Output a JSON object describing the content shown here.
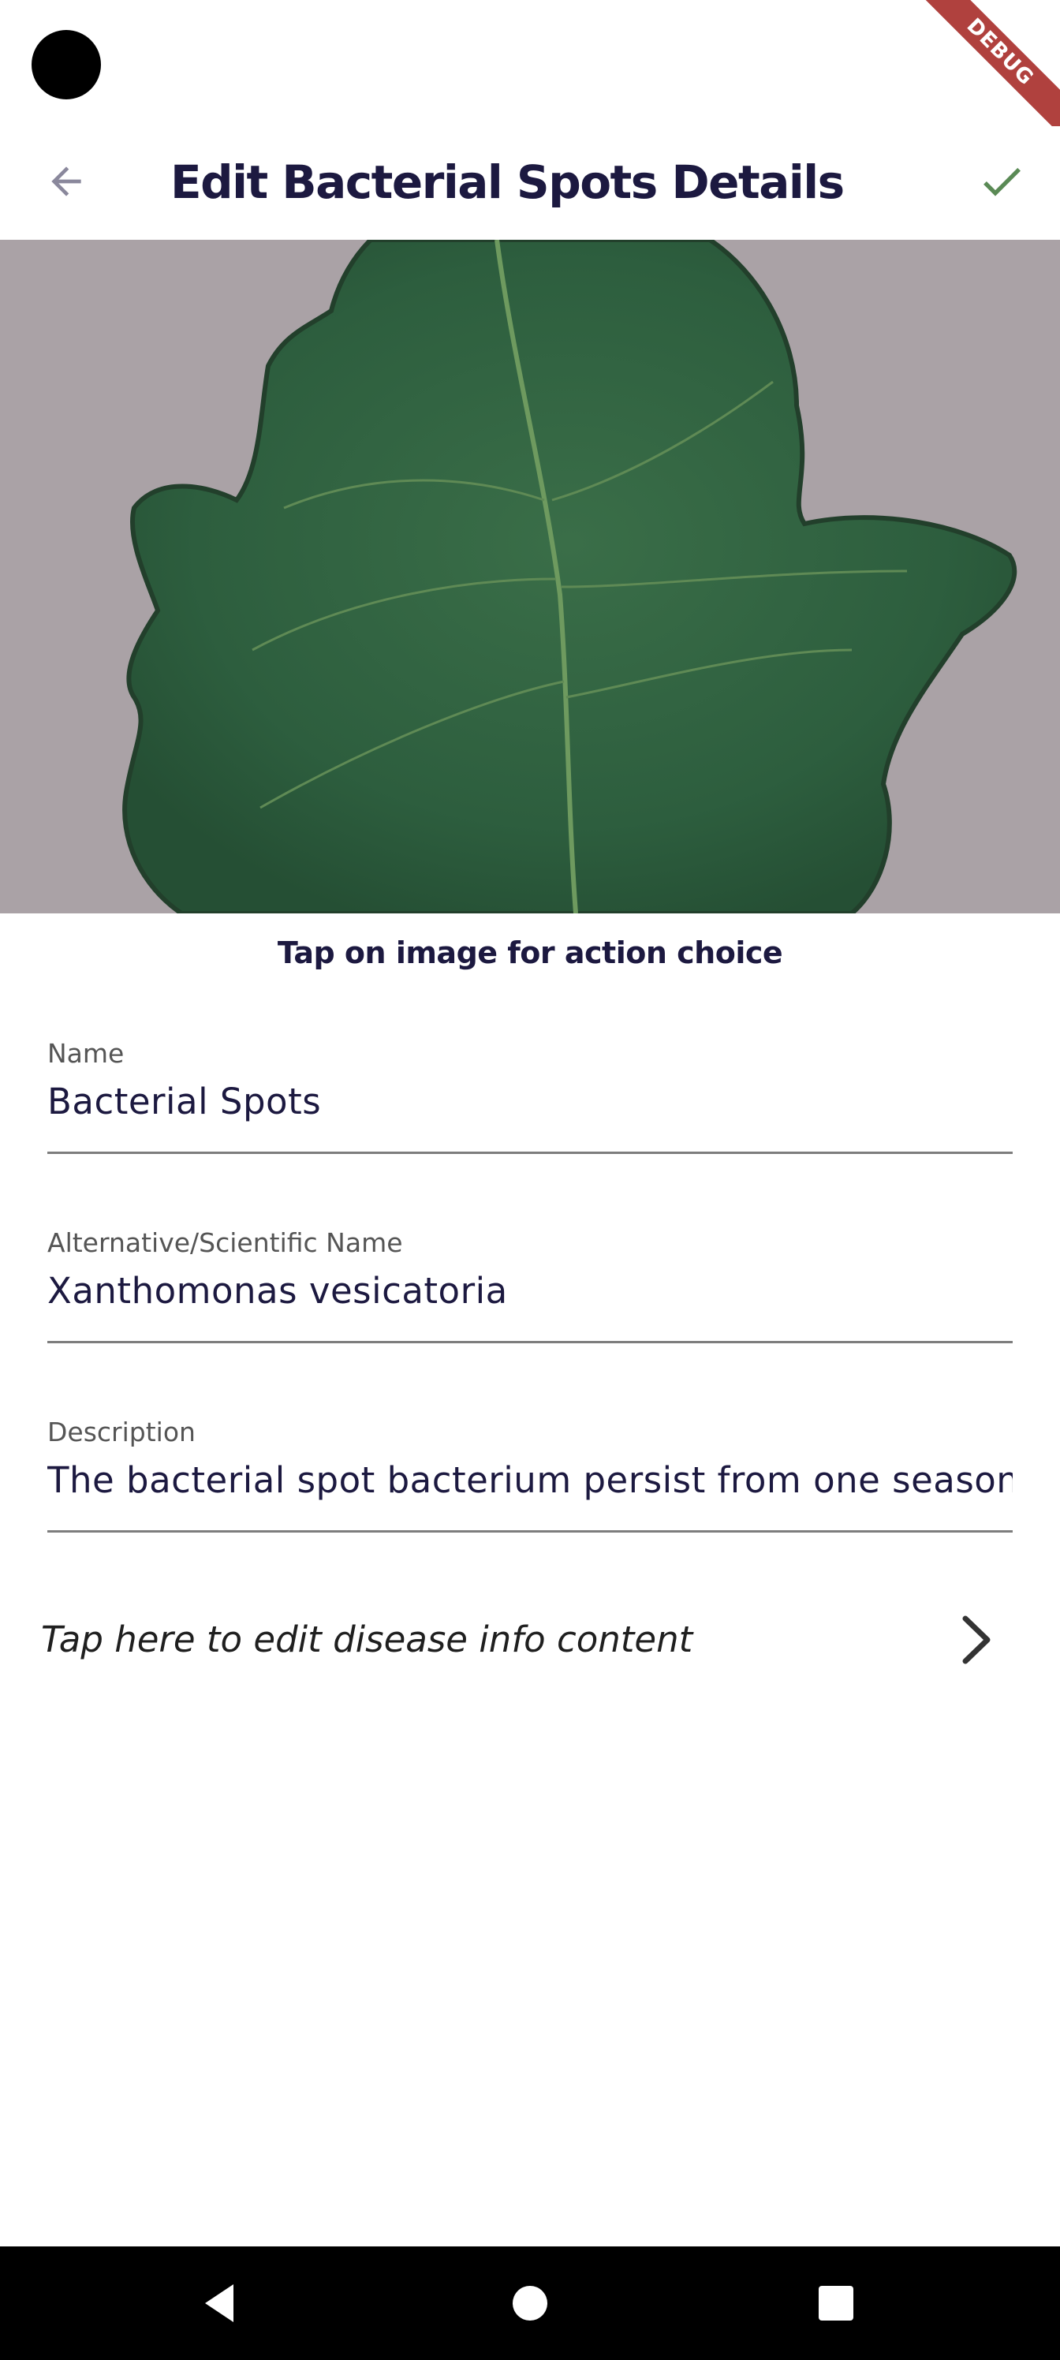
{
  "status_bar": {
    "debug_label": "DEBUG"
  },
  "app_bar": {
    "title": "Edit Bacterial Spots Details",
    "back_icon": "arrow-back-icon",
    "save_icon": "check-icon",
    "save_color": "#5a8a55"
  },
  "image": {
    "hint": "Tap on image for action choice"
  },
  "form": {
    "name": {
      "label": "Name",
      "value": "Bacterial Spots"
    },
    "alt_name": {
      "label": "Alternative/Scientific Name",
      "value": "Xanthomonas vesicatoria"
    },
    "description": {
      "label": "Description",
      "value": "The bacterial spot bacterium persist from one season to"
    }
  },
  "edit_content": {
    "label": "Tap here to edit disease info content",
    "icon": "chevron-right-icon"
  },
  "colors": {
    "title": "#1c1940",
    "leaf": "#2f6240",
    "background_surface": "#aaa2a6"
  },
  "nav_bar": {
    "back": "nav-back-icon",
    "home": "nav-home-icon",
    "recents": "nav-recents-icon"
  }
}
